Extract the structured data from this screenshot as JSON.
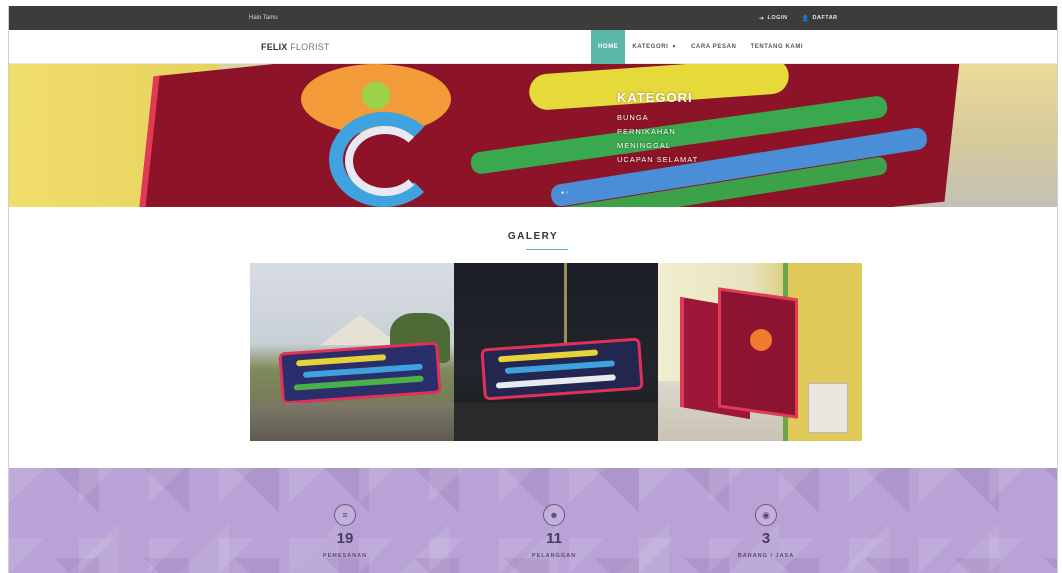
{
  "topbar": {
    "welcome": "Halo Tamu",
    "login_label": "LOGIN",
    "register_label": "DAFTAR",
    "login_icon": "sign-in-icon",
    "register_icon": "user-icon"
  },
  "navbar": {
    "brand_bold": "FELIX",
    "brand_rest": " FLORIST",
    "menu": [
      {
        "label": "HOME",
        "active": true
      },
      {
        "label": "KATEGORI",
        "active": false,
        "has_dropdown": true
      },
      {
        "label": "CARA PESAN",
        "active": false
      },
      {
        "label": "TENTANG KAMI",
        "active": false
      }
    ],
    "accent_color": "#5cb8a8"
  },
  "hero": {
    "kategori_title": "KATEGORI",
    "kategori_items": [
      "BUNGA",
      "PERNIKAHAN",
      "MENINGGAL",
      "UCAPAN SELAMAT"
    ]
  },
  "gallery": {
    "title": "GALERY"
  },
  "stats": {
    "background_color": "#b9a3d6",
    "items": [
      {
        "icon": "list-icon",
        "value": "19",
        "label": "PEMESANAN"
      },
      {
        "icon": "users-icon",
        "value": "11",
        "label": "PELANGGAN"
      },
      {
        "icon": "eye-icon",
        "value": "3",
        "label": "BARANG / JASA"
      }
    ]
  }
}
